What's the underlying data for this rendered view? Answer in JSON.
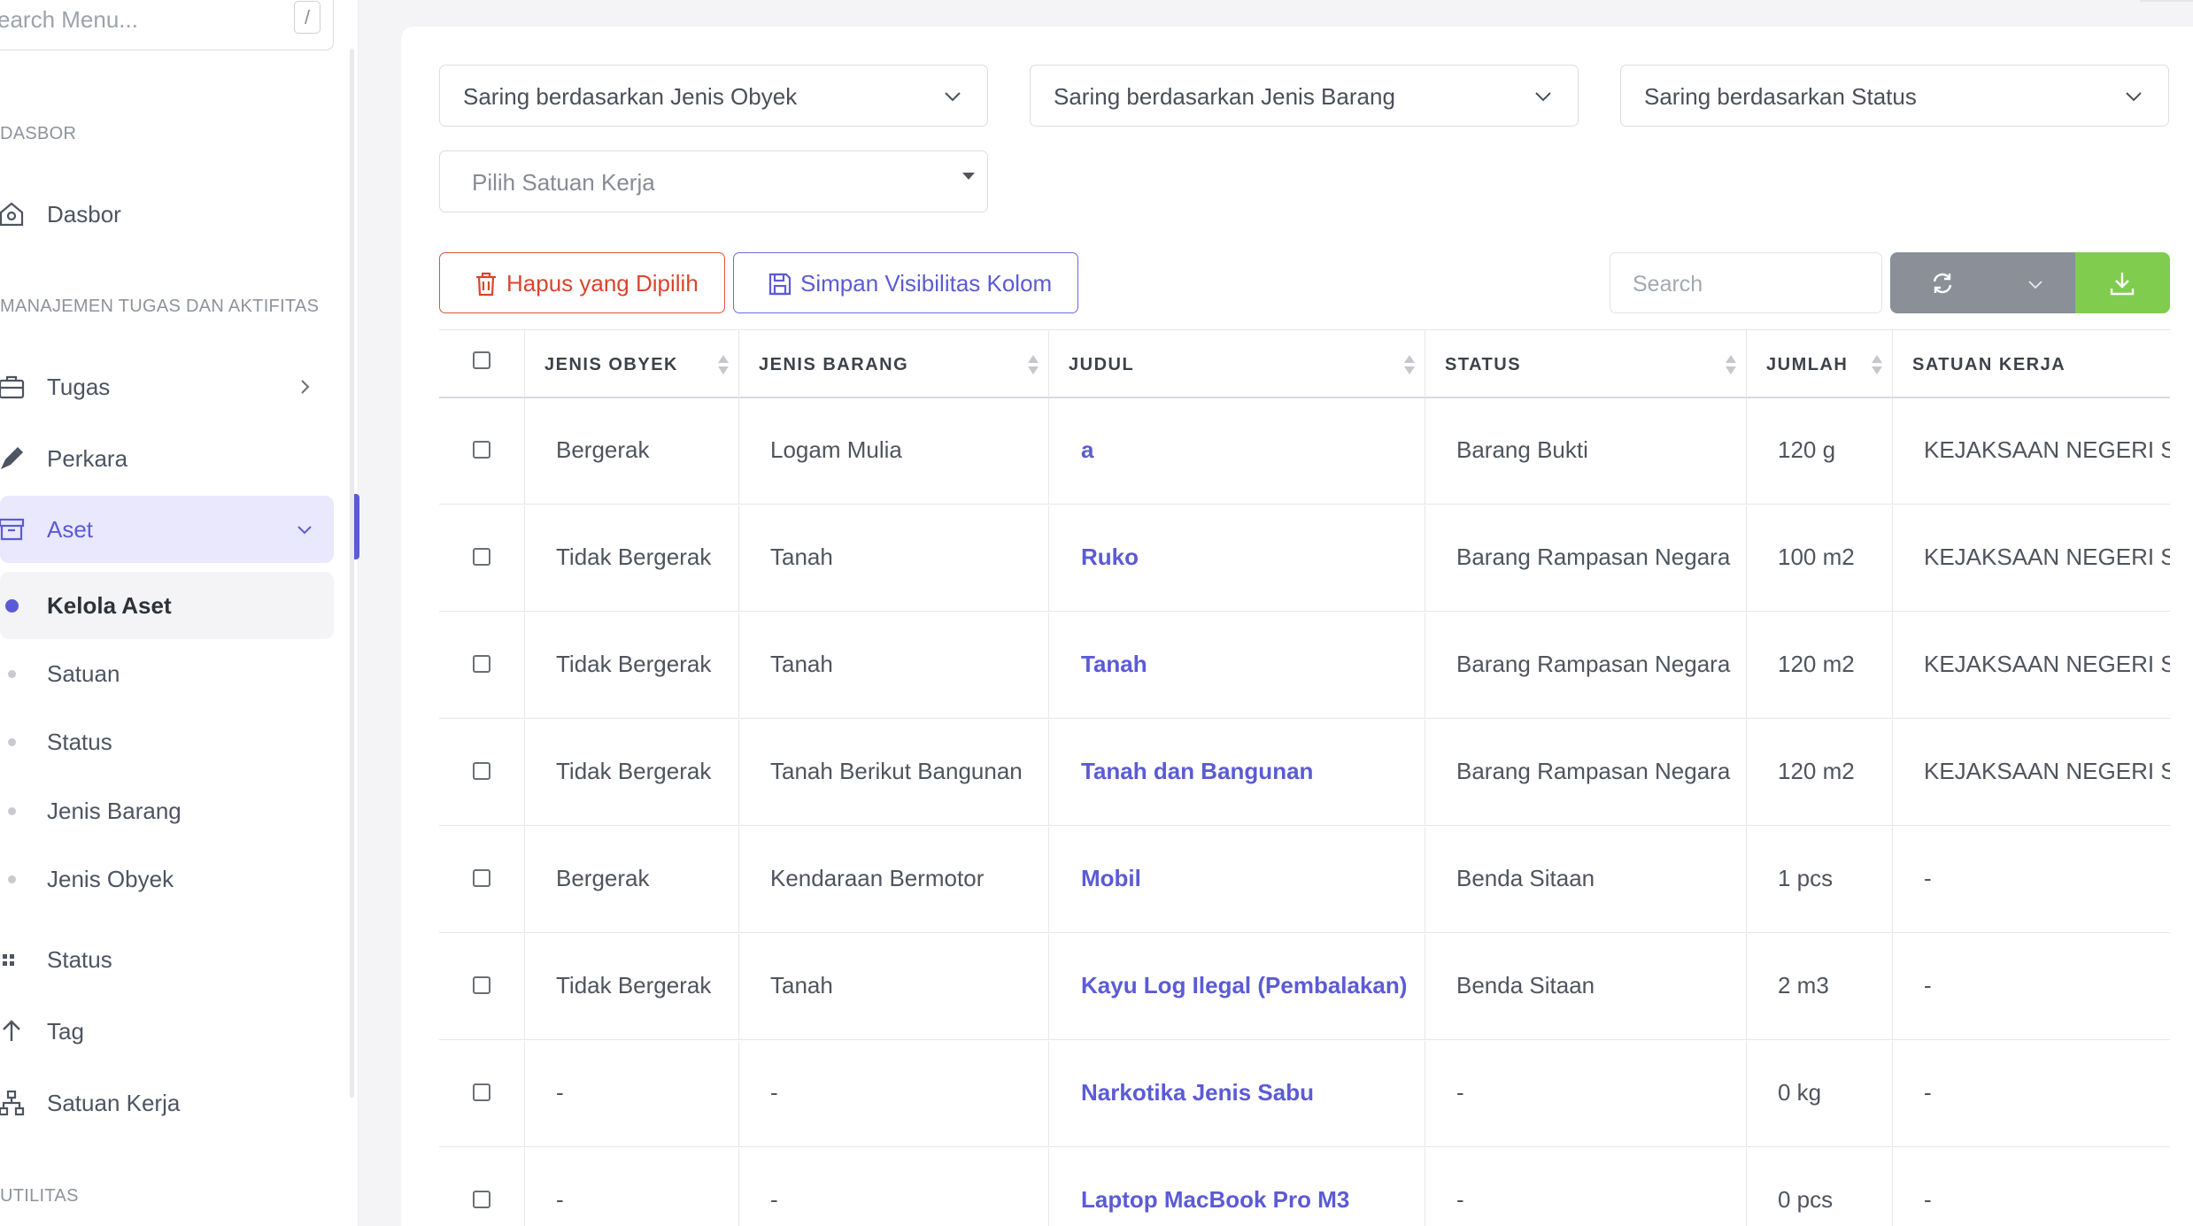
{
  "sidebar": {
    "search_placeholder": "earch Menu...",
    "search_shortcut": "/",
    "sections": {
      "dasbor": "DASBOR",
      "manajemen": "MANAJEMEN TUGAS DAN AKTIFITAS",
      "utilitas": "UTILITAS"
    },
    "items": {
      "dasbor": "Dasbor",
      "tugas": "Tugas",
      "perkara": "Perkara",
      "aset": "Aset",
      "status": "Status",
      "tag": "Tag",
      "satuan_kerja": "Satuan Kerja"
    },
    "sub_items": {
      "kelola_aset": "Kelola Aset",
      "satuan": "Satuan",
      "status": "Status",
      "jenis_barang": "Jenis Barang",
      "jenis_obyek": "Jenis Obyek"
    }
  },
  "filters": {
    "jenis_obyek": "Saring berdasarkan Jenis Obyek",
    "jenis_barang": "Saring berdasarkan Jenis Barang",
    "status": "Saring berdasarkan Status",
    "satuan_kerja": "Pilih Satuan Kerja"
  },
  "toolbar": {
    "delete_label": "Hapus yang Dipilih",
    "save_visibility_label": "Simpan Visibilitas Kolom",
    "search_placeholder": "Search"
  },
  "table": {
    "headers": {
      "jenis_obyek": "JENIS OBYEK",
      "jenis_barang": "JENIS BARANG",
      "judul": "JUDUL",
      "status": "STATUS",
      "jumlah": "JUMLAH",
      "satuan_kerja": "SATUAN KERJA"
    },
    "rows": [
      {
        "jenis_obyek": "Bergerak",
        "jenis_barang": "Logam Mulia",
        "judul": "a",
        "status": "Barang Bukti",
        "jumlah": "120 g",
        "satuan_kerja": "KEJAKSAAN NEGERI SER"
      },
      {
        "jenis_obyek": "Tidak Bergerak",
        "jenis_barang": "Tanah",
        "judul": "Ruko",
        "status": "Barang Rampasan Negara",
        "jumlah": "100 m2",
        "satuan_kerja": "KEJAKSAAN NEGERI SER"
      },
      {
        "jenis_obyek": "Tidak Bergerak",
        "jenis_barang": "Tanah",
        "judul": "Tanah",
        "status": "Barang Rampasan Negara",
        "jumlah": "120 m2",
        "satuan_kerja": "KEJAKSAAN NEGERI SER"
      },
      {
        "jenis_obyek": "Tidak Bergerak",
        "jenis_barang": "Tanah Berikut Bangunan",
        "judul": "Tanah dan Bangunan",
        "status": "Barang Rampasan Negara",
        "jumlah": "120 m2",
        "satuan_kerja": "KEJAKSAAN NEGERI SER"
      },
      {
        "jenis_obyek": "Bergerak",
        "jenis_barang": "Kendaraan Bermotor",
        "judul": "Mobil",
        "status": "Benda Sitaan",
        "jumlah": "1 pcs",
        "satuan_kerja": "-"
      },
      {
        "jenis_obyek": "Tidak Bergerak",
        "jenis_barang": "Tanah",
        "judul": "Kayu Log Ilegal (Pembalakan)",
        "status": "Benda Sitaan",
        "jumlah": "2 m3",
        "satuan_kerja": "-"
      },
      {
        "jenis_obyek": "-",
        "jenis_barang": "-",
        "judul": "Narkotika Jenis Sabu",
        "status": "-",
        "jumlah": "0 kg",
        "satuan_kerja": "-"
      },
      {
        "jenis_obyek": "-",
        "jenis_barang": "-",
        "judul": "Laptop MacBook Pro M3",
        "status": "-",
        "jumlah": "0 pcs",
        "satuan_kerja": "-"
      }
    ]
  },
  "colors": {
    "accent": "#5b5bd6",
    "danger": "#d8462e",
    "success": "#80cc4f",
    "neutral_button": "#8a8f98"
  }
}
